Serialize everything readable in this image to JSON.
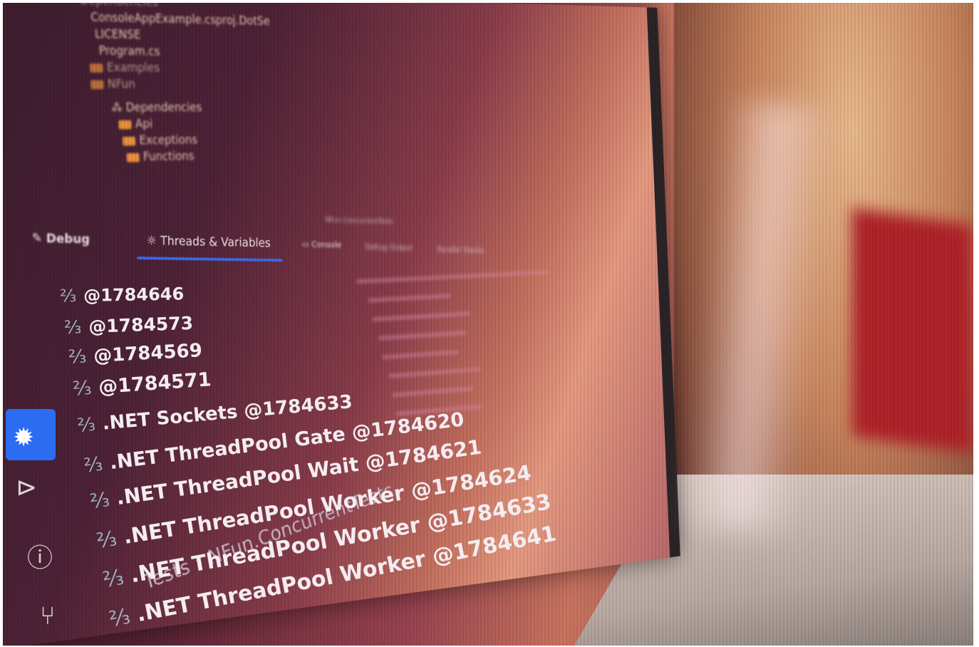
{
  "project_tree": {
    "items": [
      {
        "label": "Dependencies",
        "kind": "folder"
      },
      {
        "label": "ConsoleAppExample.csproj.DotSe",
        "kind": "file"
      },
      {
        "label": "LICENSE",
        "kind": "file"
      },
      {
        "label": "Program.cs",
        "kind": "file"
      },
      {
        "label": "Examples",
        "kind": "folder"
      },
      {
        "label": "NFun",
        "kind": "folder"
      },
      {
        "label": "Dependencies",
        "kind": "folder"
      },
      {
        "label": "Api",
        "kind": "folder"
      },
      {
        "label": "Exceptions",
        "kind": "folder"
      },
      {
        "label": "Functions",
        "kind": "folder"
      }
    ]
  },
  "debug_panel": {
    "title": "Debug",
    "tabs": [
      {
        "label": "Threads & Variables",
        "active": true
      },
      {
        "label": "Console"
      },
      {
        "label": "Debug Output"
      },
      {
        "label": "Parallel Stacks"
      }
    ],
    "run_config": "NFun.ConcurrentTests"
  },
  "threads": [
    "@1784646",
    "@1784573",
    "@1784569",
    "@1784571",
    ".NET Sockets @1784633",
    ".NET ThreadPool Gate @1784620",
    ".NET ThreadPool Wait @1784621",
    ".NET ThreadPool Worker @1784624",
    ".NET ThreadPool Worker @1784633",
    ".NET ThreadPool Worker @1784641"
  ],
  "breadcrumb": {
    "items": [
      "Tests",
      "NFun.ConcurrentTests"
    ]
  },
  "colors": {
    "accent": "#3d6df0",
    "active_tool": "#2b6cf0",
    "folder": "#e8903f"
  },
  "icons": [
    "thread-icon",
    "debug-icon",
    "terminal-icon",
    "problems-icon",
    "git-icon",
    "console-icon"
  ]
}
